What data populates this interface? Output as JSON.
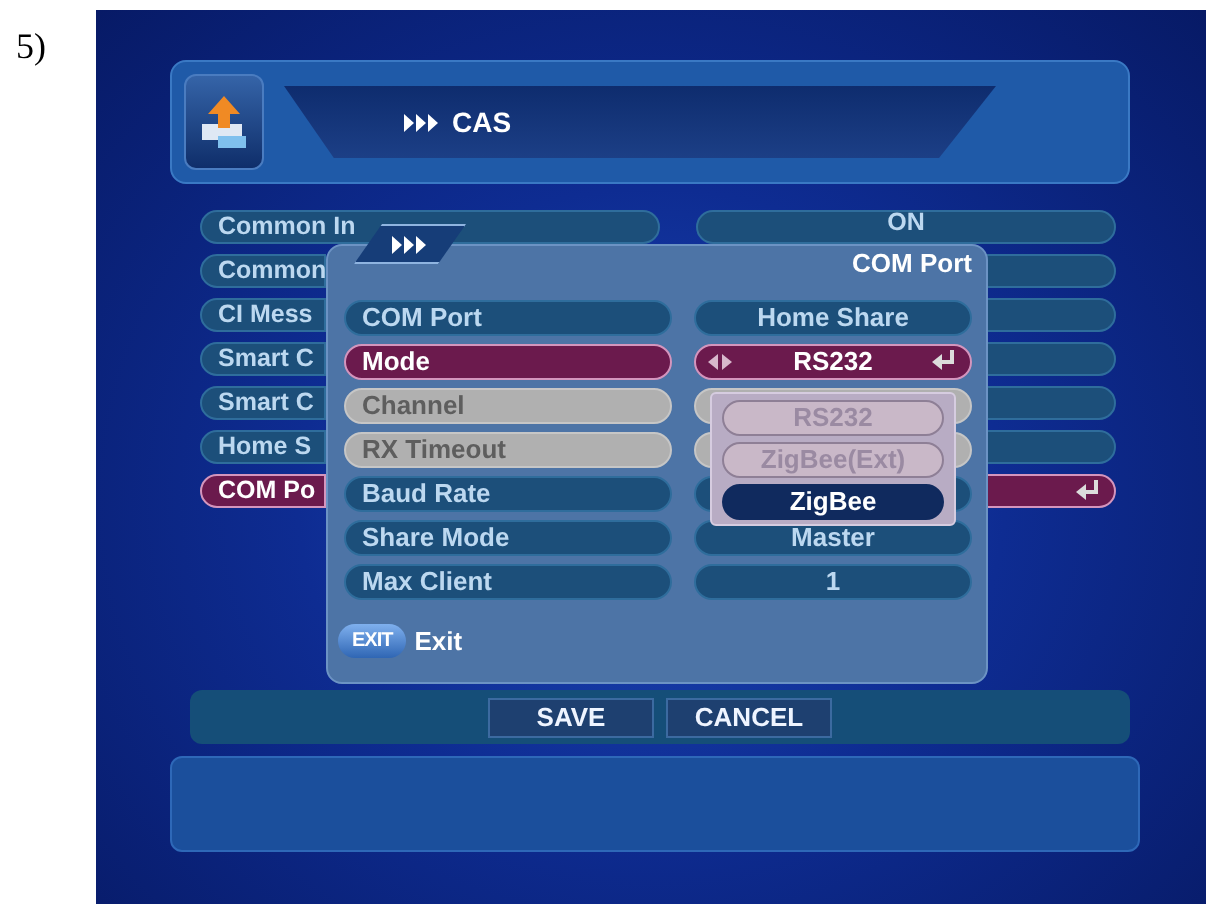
{
  "figure_label": "5)",
  "header": {
    "title": "CAS"
  },
  "background_list": [
    {
      "label": "Common In",
      "value": "ON",
      "selected": false
    },
    {
      "label": "Common",
      "selected": false
    },
    {
      "label": "CI Mess",
      "selected": false
    },
    {
      "label": "Smart C",
      "selected": false
    },
    {
      "label": "Smart C",
      "selected": false
    },
    {
      "label": "Home S",
      "selected": false
    },
    {
      "label": "COM Po",
      "selected": true
    }
  ],
  "popup": {
    "title": "COM Port",
    "rows": [
      {
        "label": "COM Port",
        "value": "Home Share",
        "selected": false,
        "disabled": false
      },
      {
        "label": "Mode",
        "value": "RS232",
        "selected": true,
        "disabled": false
      },
      {
        "label": "Channel",
        "selected": false,
        "disabled": true
      },
      {
        "label": "RX Timeout",
        "selected": false,
        "disabled": true
      },
      {
        "label": "Baud Rate",
        "selected": false,
        "disabled": false
      },
      {
        "label": "Share Mode",
        "value": "Master",
        "selected": false,
        "disabled": false
      },
      {
        "label": "Max Client",
        "value": "1",
        "selected": false,
        "disabled": false
      }
    ],
    "dropdown": [
      {
        "label": "RS232",
        "selected": false
      },
      {
        "label": "ZigBee(Ext)",
        "selected": false
      },
      {
        "label": "ZigBee",
        "selected": true
      }
    ],
    "exit": {
      "key": "EXIT",
      "label": "Exit"
    }
  },
  "buttons": [
    {
      "label": "SAVE"
    },
    {
      "label": "CANCEL"
    }
  ]
}
